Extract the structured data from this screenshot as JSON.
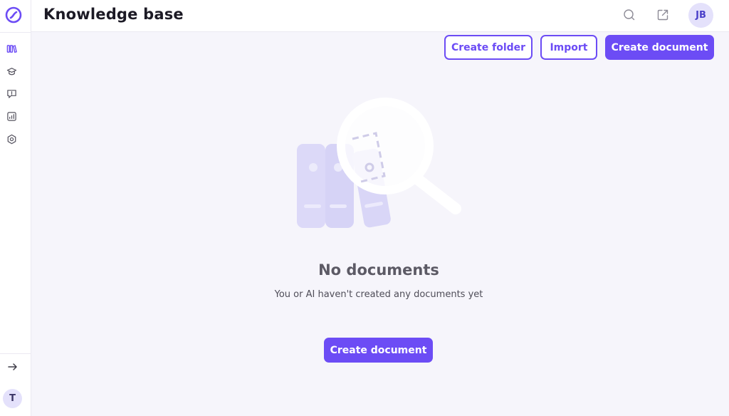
{
  "app": {
    "title": "Knowledge base",
    "accent_color": "#6c4cf5"
  },
  "sidebar": {
    "nav": [
      {
        "name": "library",
        "icon": "books-icon"
      },
      {
        "name": "learning",
        "icon": "graduation-cap-icon"
      },
      {
        "name": "support",
        "icon": "chat-bubble-icon"
      },
      {
        "name": "analytics",
        "icon": "chart-icon"
      },
      {
        "name": "settings",
        "icon": "gear-icon"
      }
    ],
    "expand_icon": "arrow-right-icon",
    "workspace_initial": "T"
  },
  "header": {
    "search_icon": "search-icon",
    "open_external_icon": "external-link-icon",
    "user_initials": "JB"
  },
  "toolbar": {
    "create_folder_label": "Create folder",
    "import_label": "Import",
    "create_document_label": "Create document"
  },
  "empty_state": {
    "illustration_icon": "magnifier-over-documents-icon",
    "title": "No documents",
    "description": "You or AI haven't created any documents yet",
    "button_label": "Create document"
  }
}
